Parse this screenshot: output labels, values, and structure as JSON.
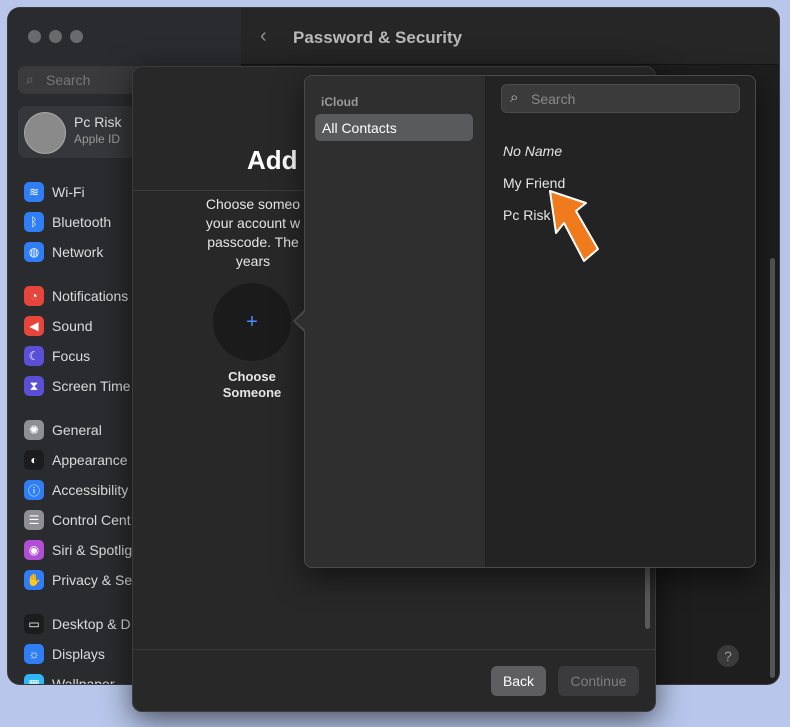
{
  "window": {
    "title": "Password & Security",
    "back_glyph": "‹"
  },
  "sidebar": {
    "search_placeholder": "Search",
    "profile": {
      "name": "Pc Risk",
      "subtitle": "Apple ID"
    },
    "items": [
      {
        "label": "Wi-Fi",
        "icon": "wifi-icon",
        "color": "#2f7ef6"
      },
      {
        "label": "Bluetooth",
        "icon": "bluetooth-icon",
        "color": "#2f7ef6"
      },
      {
        "label": "Network",
        "icon": "globe-icon",
        "color": "#2f7ef6"
      },
      {
        "label": "Notifications",
        "icon": "bell-icon",
        "color": "#e5453a"
      },
      {
        "label": "Sound",
        "icon": "speaker-icon",
        "color": "#e5453a"
      },
      {
        "label": "Focus",
        "icon": "moon-icon",
        "color": "#5b4fd6"
      },
      {
        "label": "Screen Time",
        "icon": "hourglass-icon",
        "color": "#5b4fd6"
      },
      {
        "label": "General",
        "icon": "gear-icon",
        "color": "#8e8e93"
      },
      {
        "label": "Appearance",
        "icon": "appearance-icon",
        "color": "#1c1c1e"
      },
      {
        "label": "Accessibility",
        "icon": "accessibility-icon",
        "color": "#2f7ef6"
      },
      {
        "label": "Control Cent",
        "icon": "control-center-icon",
        "color": "#8e8e93"
      },
      {
        "label": "Siri & Spotlig",
        "icon": "siri-icon",
        "color": "#b04fd6"
      },
      {
        "label": "Privacy & Se",
        "icon": "hand-icon",
        "color": "#2f7ef6"
      },
      {
        "label": "Desktop & D",
        "icon": "desktop-icon",
        "color": "#1c1c1e"
      },
      {
        "label": "Displays",
        "icon": "sun-icon",
        "color": "#2f7ef6"
      },
      {
        "label": "Wallpaper",
        "icon": "wallpaper-icon",
        "color": "#2fb7f6"
      }
    ]
  },
  "sheet": {
    "title": "Add",
    "description": "Choose someo your account w passcode. The years",
    "choose_plus": "+",
    "choose_label": "Choose Someone",
    "back_label": "Back",
    "continue_label": "Continue"
  },
  "popover": {
    "group_header": "iCloud",
    "group_selected": "All Contacts",
    "search_placeholder": "Search",
    "contacts": [
      "No Name",
      "My Friend",
      "Pc Risk"
    ]
  },
  "help_label": "?",
  "colors": {
    "accent": "#4a8cff",
    "pointer_arrow": "#f07b1c"
  }
}
